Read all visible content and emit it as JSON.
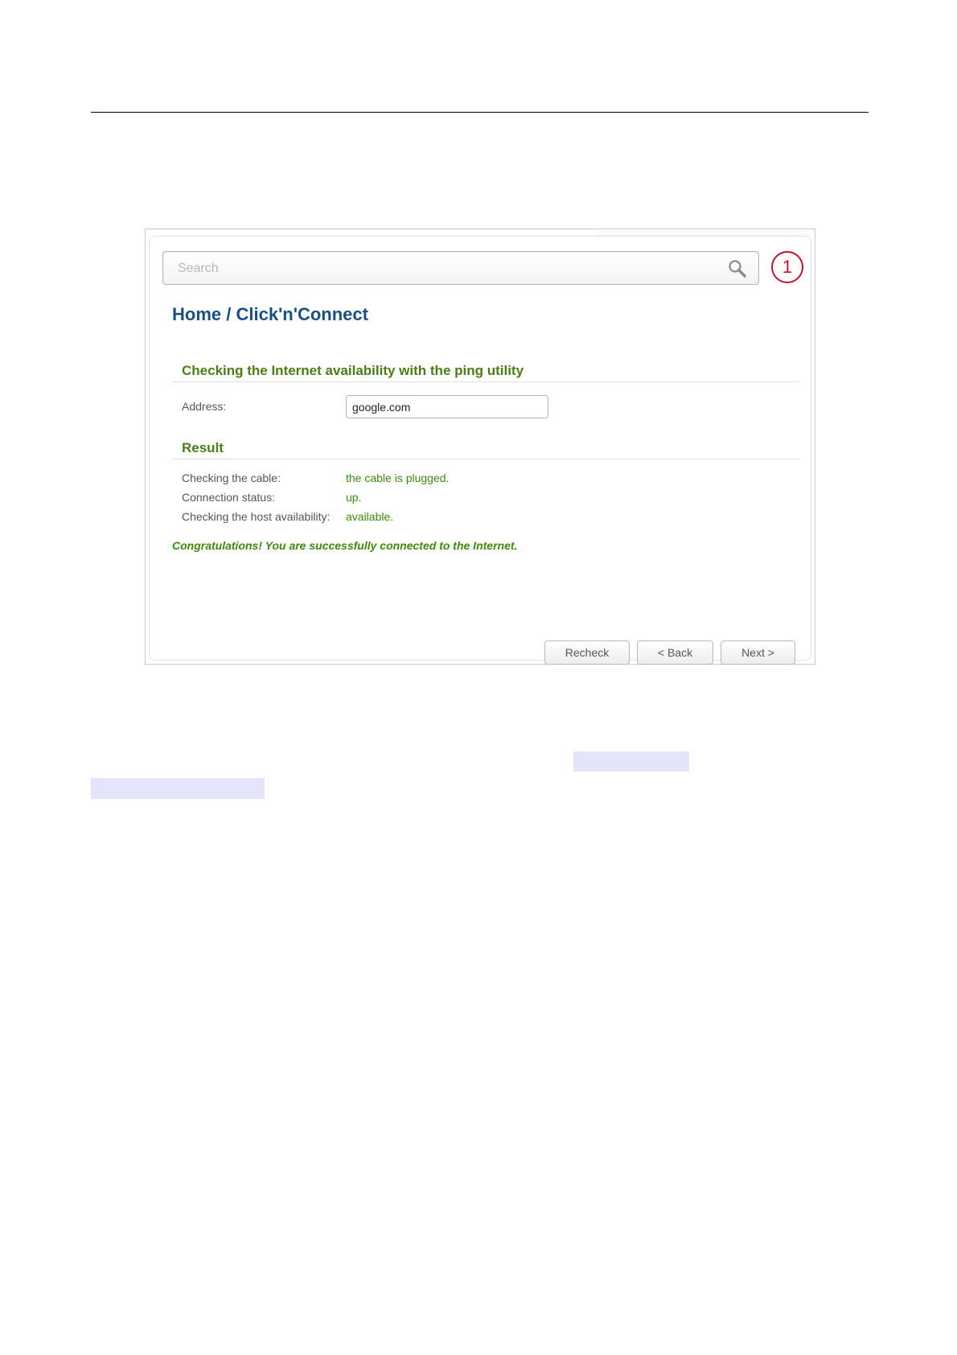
{
  "search": {
    "placeholder": "Search"
  },
  "notification": {
    "count": "1"
  },
  "breadcrumb": {
    "home": "Home /",
    "current": "Click'n'Connect"
  },
  "ping_section": {
    "title": "Checking the Internet availability with the ping utility",
    "address_label": "Address:",
    "address_value": "google.com"
  },
  "result_section": {
    "title": "Result",
    "rows": [
      {
        "label": "Checking the cable:",
        "value": "the cable is plugged."
      },
      {
        "label": "Connection status:",
        "value": "up."
      },
      {
        "label": "Checking the host availability:",
        "value": "available."
      }
    ],
    "message": "Congratulations! You are successfully connected to the Internet."
  },
  "buttons": {
    "recheck": "Recheck",
    "back": "< Back",
    "next": "Next >"
  },
  "colors": {
    "breadcrumb": "#1b4f84",
    "section_title": "#4a7d16",
    "status_value": "#3d8a0c",
    "badge": "#c8102e",
    "highlight": "#e4e4fb"
  }
}
